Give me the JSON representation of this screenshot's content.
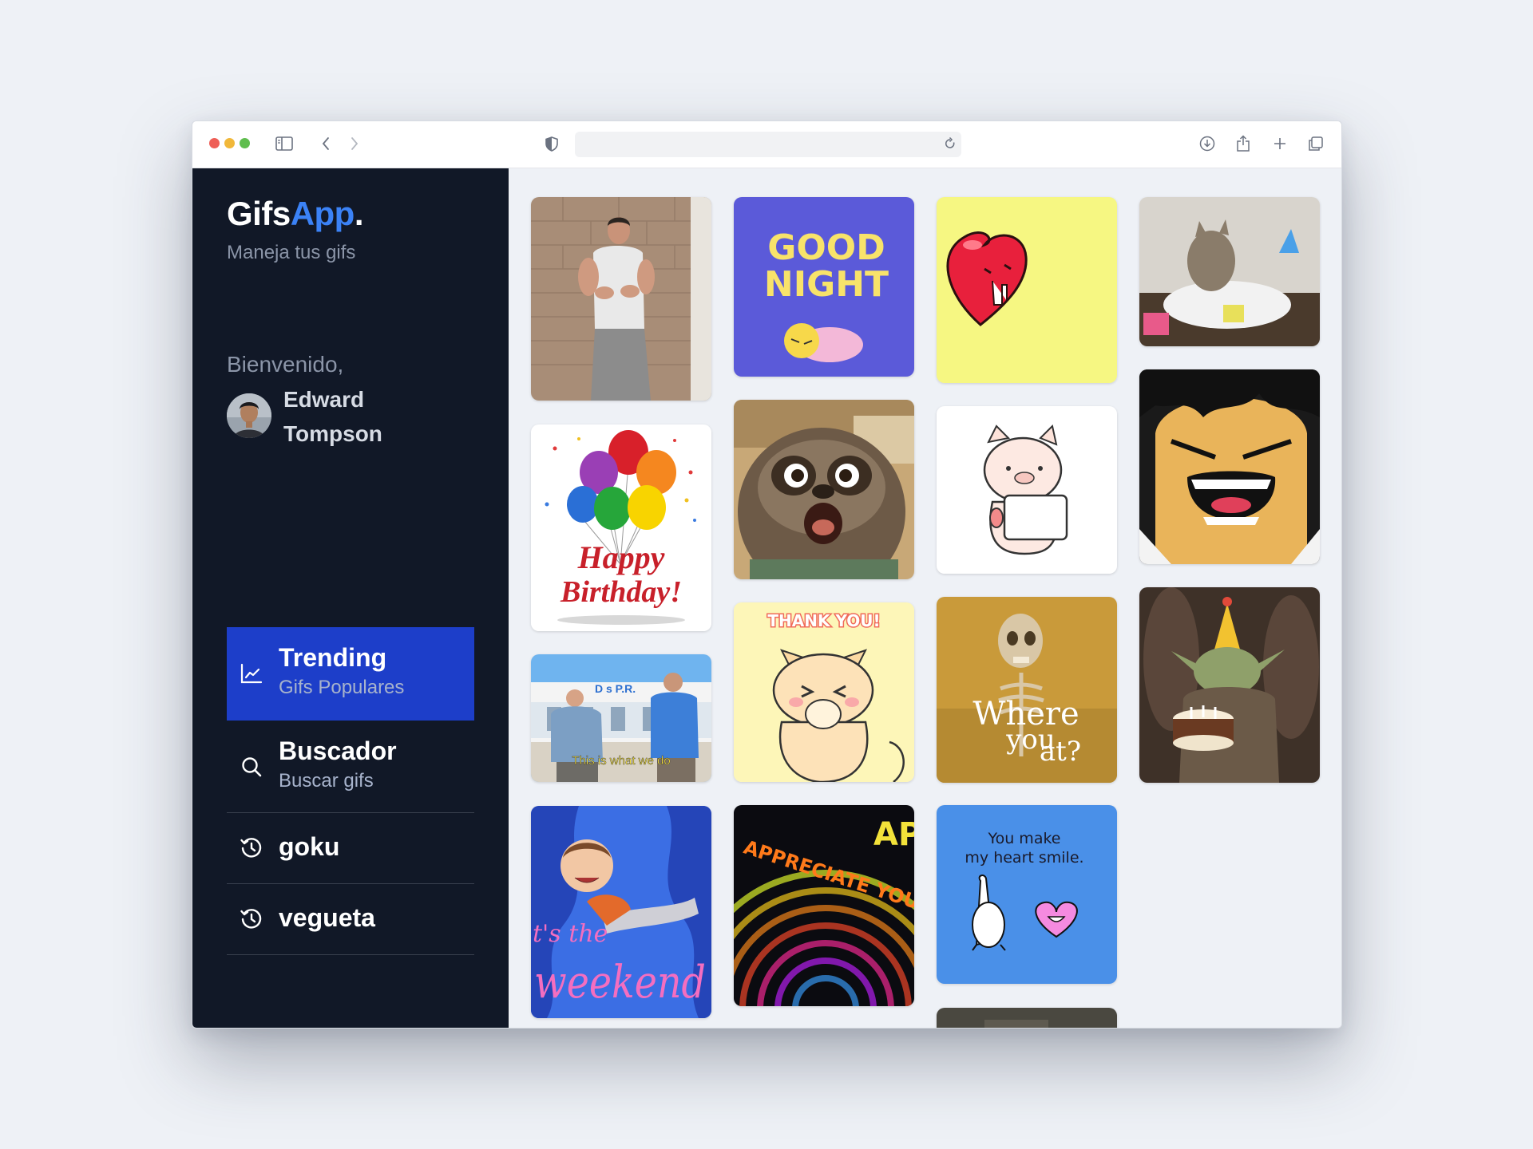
{
  "brand": {
    "name": "Gifs",
    "accent": "App",
    "dot": ".",
    "subtitle": "Maneja tus gifs"
  },
  "user": {
    "greeting": "Bienvenido,",
    "first_name": "Edward",
    "last_name": "Tompson"
  },
  "nav": {
    "trending": {
      "title": "Trending",
      "subtitle": "Gifs Populares"
    },
    "search": {
      "title": "Buscador",
      "subtitle": "Buscar gifs"
    },
    "history": [
      {
        "label": "goku"
      },
      {
        "label": "vegueta"
      }
    ]
  },
  "gif_texts": {
    "good_night_1": "GOOD",
    "good_night_2": "NIGHT",
    "happy": "Happy",
    "birthday": "Birthday!",
    "thank_you": "THANK YOU!",
    "this_is": "This is what we do",
    "where_1": "Where",
    "where_2": "you",
    "where_3": "at?",
    "weekend_1": "t's the",
    "weekend_2": "weekend",
    "appreciate": "APPRECIATE YOU",
    "heart_1": "You make",
    "heart_2": "my heart smile."
  },
  "colors": {
    "sidebar": "#111827",
    "accent": "#3b82f6",
    "nav_active": "#1d3ec9",
    "content_bg": "#eef1f6"
  },
  "icons": {
    "trending": "trending-chart-icon",
    "search": "search-icon",
    "history": "history-icon"
  }
}
